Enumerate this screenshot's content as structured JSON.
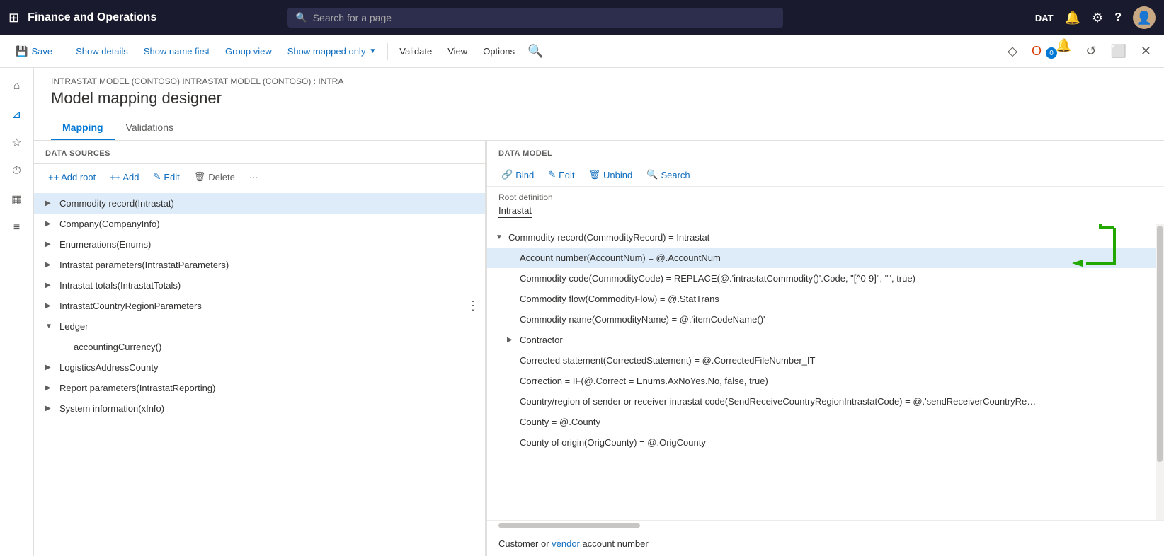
{
  "app": {
    "title": "Finance and Operations",
    "env_label": "DAT"
  },
  "search": {
    "placeholder": "Search for a page"
  },
  "toolbar": {
    "save": "Save",
    "show_details": "Show details",
    "show_name_first": "Show name first",
    "group_view": "Group view",
    "show_mapped_only": "Show mapped only",
    "validate": "Validate",
    "view": "View",
    "options": "Options"
  },
  "breadcrumb": {
    "text": "INTRASTAT MODEL (CONTOSO) INTRASTAT MODEL (CONTOSO) : INTRA"
  },
  "page_title": "Model mapping designer",
  "tabs": [
    {
      "label": "Mapping",
      "active": true
    },
    {
      "label": "Validations",
      "active": false
    }
  ],
  "left_panel": {
    "header": "DATA SOURCES",
    "add_root": "+ Add root",
    "add": "+ Add",
    "edit": "Edit",
    "delete": "Delete",
    "items": [
      {
        "label": "Commodity record(Intrastat)",
        "level": 0,
        "expanded": true,
        "selected": true
      },
      {
        "label": "Company(CompanyInfo)",
        "level": 0,
        "expanded": false
      },
      {
        "label": "Enumerations(Enums)",
        "level": 0,
        "expanded": false
      },
      {
        "label": "Intrastat parameters(IntrastatParameters)",
        "level": 0,
        "expanded": false
      },
      {
        "label": "Intrastat totals(IntrastatTotals)",
        "level": 0,
        "expanded": false
      },
      {
        "label": "IntrastatCountryRegionParameters",
        "level": 0,
        "expanded": false
      },
      {
        "label": "Ledger",
        "level": 0,
        "expanded": true
      },
      {
        "label": "accountingCurrency()",
        "level": 1,
        "expanded": false
      },
      {
        "label": "LogisticsAddressCounty",
        "level": 0,
        "expanded": false
      },
      {
        "label": "Report parameters(IntrastatReporting)",
        "level": 0,
        "expanded": false
      },
      {
        "label": "System information(xInfo)",
        "level": 0,
        "expanded": false
      }
    ]
  },
  "right_panel": {
    "header": "DATA MODEL",
    "bind": "Bind",
    "edit": "Edit",
    "unbind": "Unbind",
    "search": "Search",
    "root_def_label": "Root definition",
    "root_def_value": "Intrastat",
    "items": [
      {
        "label": "Commodity record(CommodityRecord) = Intrastat",
        "level": 0,
        "expanded": true,
        "has_expand": true
      },
      {
        "label": "Account number(AccountNum) = @.AccountNum",
        "level": 1,
        "selected": true
      },
      {
        "label": "Commodity code(CommodityCode) = REPLACE(@.'intrastatCommodity()'.Code, \"[^0-9]\", \"\", true)",
        "level": 1
      },
      {
        "label": "Commodity flow(CommodityFlow) = @.StatTrans",
        "level": 1
      },
      {
        "label": "Commodity name(CommodityName) = @.'itemCodeName()'",
        "level": 1
      },
      {
        "label": "Contractor",
        "level": 1,
        "has_expand": true
      },
      {
        "label": "Corrected statement(CorrectedStatement) = @.CorrectedFileNumber_IT",
        "level": 1
      },
      {
        "label": "Correction = IF(@.Correct = Enums.AxNoYes.No, false, true)",
        "level": 1
      },
      {
        "label": "Country/region of sender or receiver intrastat code(SendReceiveCountryRegionIntrastatCode) = @.'sendReceiverCountryRe…",
        "level": 1
      },
      {
        "label": "County = @.County",
        "level": 1
      },
      {
        "label": "County of origin(OrigCounty) = @.OrigCounty",
        "level": 1
      }
    ],
    "bottom_text": "Customer or vendor account number"
  },
  "icons": {
    "grid": "⊞",
    "search_small": "🔍",
    "bell": "🔔",
    "gear": "⚙",
    "question": "?",
    "home": "⌂",
    "star": "☆",
    "history": "⏱",
    "grid2": "▦",
    "list": "≡",
    "save": "💾",
    "filter": "⊿",
    "link": "🔗",
    "edit_pen": "✎",
    "trash": "🗑",
    "dots": "···",
    "plus": "+",
    "expand_right": "▶",
    "expand_down": "▼"
  }
}
